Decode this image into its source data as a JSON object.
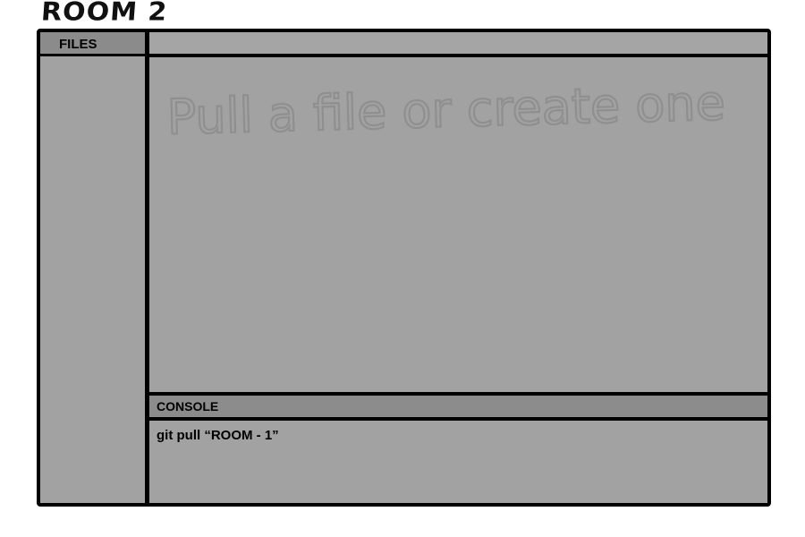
{
  "room": {
    "title": "ROOM 2"
  },
  "sidebar": {
    "header_label": "FILES"
  },
  "editor": {
    "empty_hint": "Pull a file or create one!"
  },
  "console": {
    "header_label": "CONSOLE",
    "lines": [
      "git pull “ROOM - 1”"
    ]
  },
  "colors": {
    "panel": "#a2a2a2",
    "header": "#8b8b8b",
    "border": "#000000",
    "hint_stroke": "#8f8f8f"
  }
}
